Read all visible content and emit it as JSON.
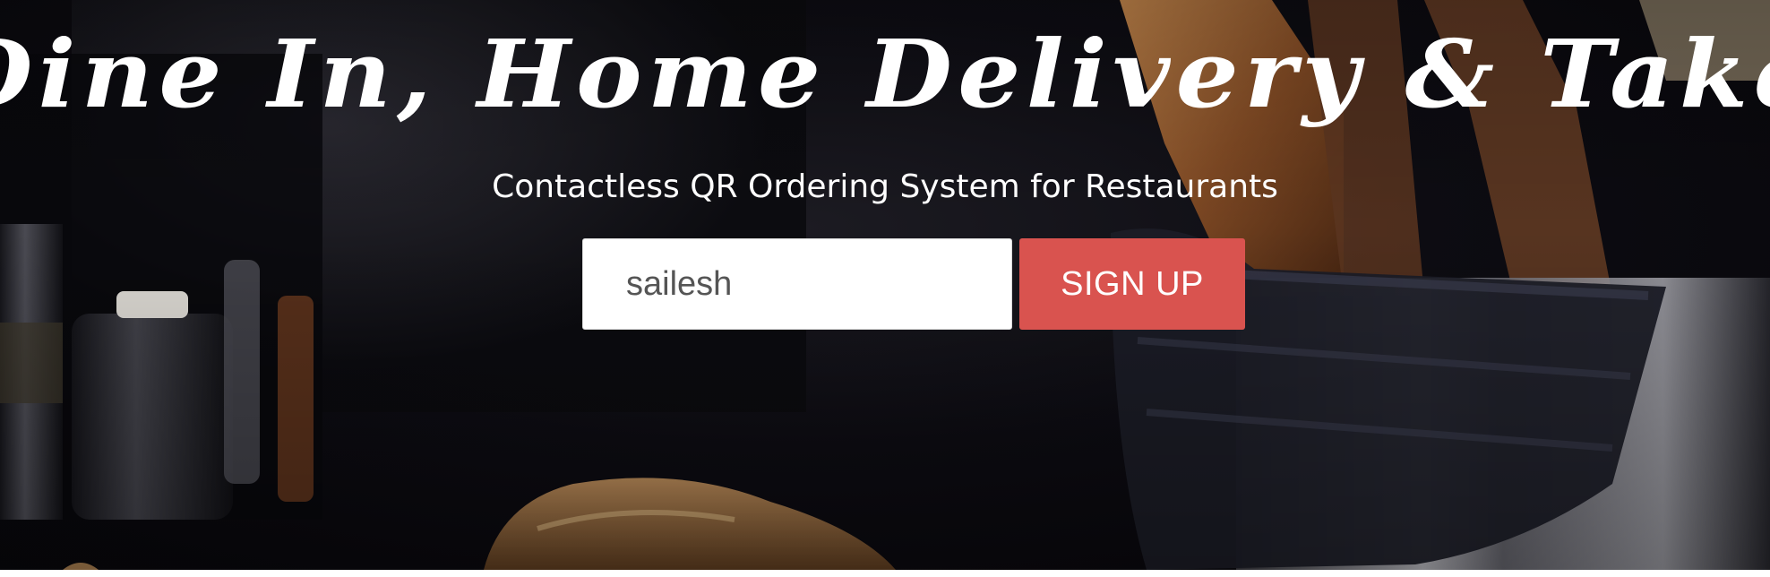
{
  "hero": {
    "title": "Dine In, Home Delivery & Take-Out",
    "subtitle": "Contactless QR Ordering System for Restaurants"
  },
  "signup": {
    "name_value": "sailesh",
    "button_label": "SIGN UP"
  },
  "colors": {
    "accent": "#d9534f",
    "hero_background": "#0b0a10",
    "text": "#ffffff"
  }
}
